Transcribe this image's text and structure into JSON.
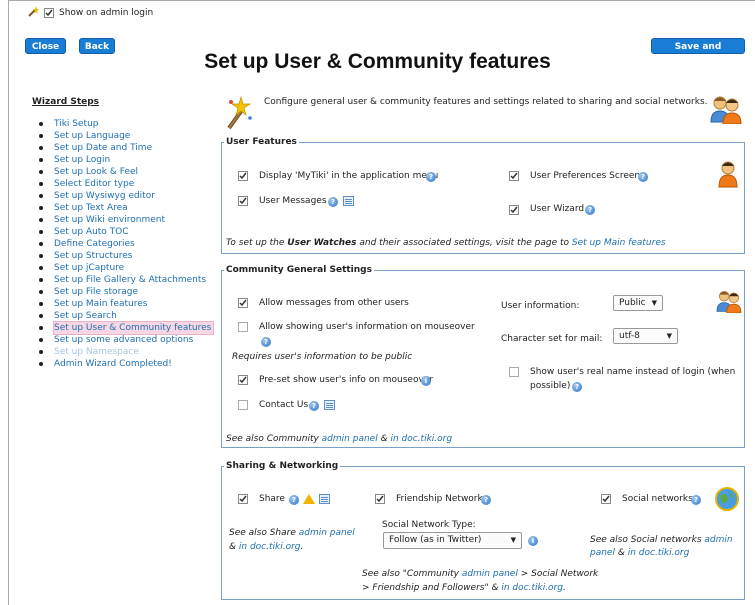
{
  "header": {
    "show_on_admin_login": "Show on admin login",
    "close": "Close",
    "back": "Back",
    "save_continue": "Save and Continue",
    "title": "Set up User & Community features"
  },
  "sidebar": {
    "title": "Wizard Steps",
    "items": [
      {
        "label": "Tiki Setup"
      },
      {
        "label": "Set up Language"
      },
      {
        "label": "Set up Date and Time"
      },
      {
        "label": "Set up Login"
      },
      {
        "label": "Set up Look & Feel"
      },
      {
        "label": "Select Editor type"
      },
      {
        "label": "Set up Wysiwyg editor"
      },
      {
        "label": "Set up Text Area"
      },
      {
        "label": "Set up Wiki environment"
      },
      {
        "label": "Set up Auto TOC"
      },
      {
        "label": "Define Categories"
      },
      {
        "label": "Set up Structures"
      },
      {
        "label": "Set up jCapture"
      },
      {
        "label": "Set up File Gallery & Attachments"
      },
      {
        "label": "Set up File storage"
      },
      {
        "label": "Set up Main features"
      },
      {
        "label": "Set up Search"
      },
      {
        "label": "Set up User & Community features"
      },
      {
        "label": "Set up some advanced options"
      },
      {
        "label": "Set up Namespace"
      },
      {
        "label": "Admin Wizard Completed!"
      }
    ]
  },
  "intro": "Configure general user & community features and settings related to sharing and social networks.",
  "user_features": {
    "legend": "User Features",
    "mytiki": "Display 'MyTiki' in the application menu",
    "messages": "User Messages",
    "prefs": "User Preferences Screen",
    "wizard": "User Wizard",
    "note_prefix": "To set up the ",
    "note_bold": "User Watches",
    "note_mid": " and their associated settings, visit the page to ",
    "note_link": "Set up Main features"
  },
  "community": {
    "legend": "Community General Settings",
    "allow_messages": "Allow messages from other users",
    "allow_showing": "Allow showing user's information on mouseover",
    "requires": "Requires user's information to be public",
    "preset": "Pre-set show user's info on mouseover",
    "contact": "Contact Us",
    "user_info_label": "User information:",
    "user_info_value": "Public",
    "charset_label": "Character set for mail:",
    "charset_value": "utf-8",
    "realname_1": "Show user's real name instead of login (when",
    "realname_2": "possible)",
    "see_prefix": "See also Community ",
    "see_link1": "admin panel",
    "see_mid": " & ",
    "see_link2": "in doc.tiki.org"
  },
  "sharing": {
    "legend": "Sharing & Networking",
    "share": "Share",
    "friendship": "Friendship Network",
    "social": "Social networks",
    "share_see_1": "See also Share ",
    "share_link1": "admin panel",
    "share_see_2": "& ",
    "share_link2": "in doc.tiki.org",
    "share_end": ".",
    "type_label": "Social Network Type:",
    "type_value": "Follow (as in Twitter)",
    "social_see_1": "See also Social networks ",
    "social_link1": "admin",
    "social_link1b": "panel",
    "social_mid": " & ",
    "social_link2": "in doc.tiki.org",
    "comm_see_1": "See also \"Community ",
    "comm_link1": "admin panel",
    "comm_see_2": " > Social Network",
    "comm_see_3": "> Friendship and Followers\" & ",
    "comm_link2": "in doc.tiki.org",
    "comm_end": "."
  }
}
